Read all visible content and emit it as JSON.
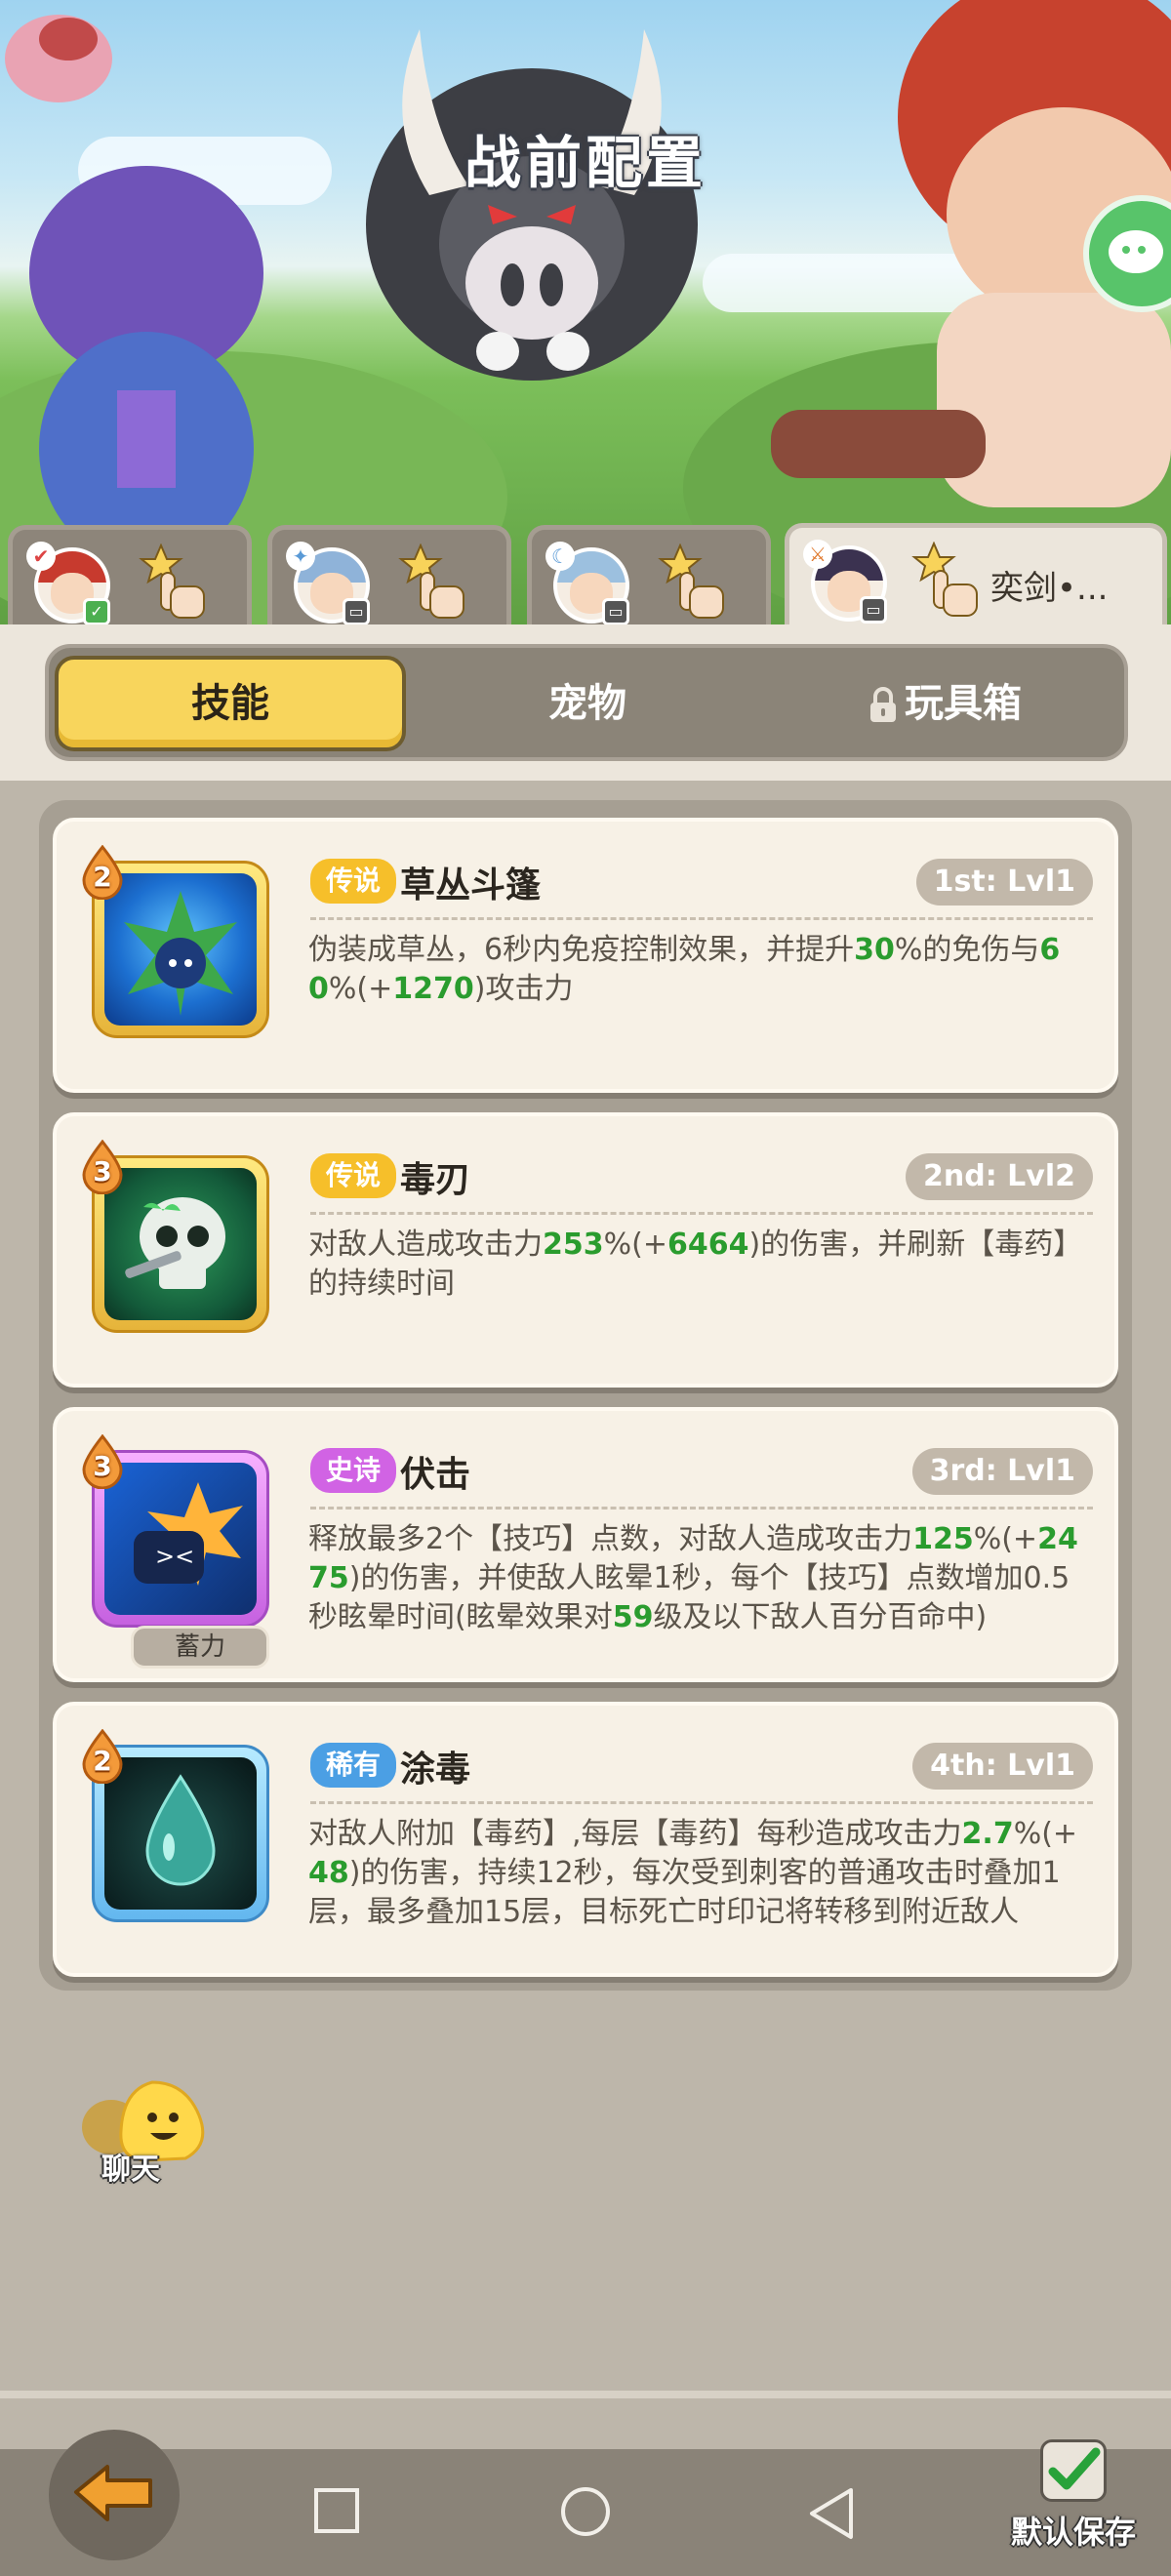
{
  "header": {
    "title": "战前配置"
  },
  "characters": [
    {
      "name": "",
      "badge_color": "#4caf50",
      "active": false
    },
    {
      "name": "",
      "badge_color": "#555555",
      "active": false
    },
    {
      "name": "",
      "badge_color": "#555555",
      "active": false
    },
    {
      "name": "奕剑•...",
      "badge_color": "#555555",
      "active": true
    }
  ],
  "tabs": {
    "skills": "技能",
    "pets": "宠物",
    "toybox": "玩具箱",
    "active": "skills"
  },
  "skills": [
    {
      "rarity": "传说",
      "name": "草丛斗篷",
      "slot_level": "1st: Lvl1",
      "tier": "2",
      "desc": [
        {
          "t": "伪装成草丛，6秒内免疫控制效果，并提升"
        },
        {
          "t": "30",
          "hl": true
        },
        {
          "t": "%的免伤与"
        },
        {
          "t": "60",
          "hl": true
        },
        {
          "t": "%(+"
        },
        {
          "t": "1270",
          "hl": true
        },
        {
          "t": ")攻击力"
        }
      ]
    },
    {
      "rarity": "传说",
      "name": "毒刃",
      "slot_level": "2nd: Lvl2",
      "tier": "3",
      "desc": [
        {
          "t": "对敌人造成攻击力"
        },
        {
          "t": "253",
          "hl": true
        },
        {
          "t": "%(+"
        },
        {
          "t": "6464",
          "hl": true
        },
        {
          "t": ")的伤害，并刷新【毒药】的持续时间"
        }
      ]
    },
    {
      "rarity": "史诗",
      "name": "伏击",
      "slot_level": "3rd: Lvl1",
      "tier": "3",
      "extra_label": "蓄力",
      "desc": [
        {
          "t": "释放最多2个【技巧】点数，对敌人造成攻击力"
        },
        {
          "t": "125",
          "hl": true
        },
        {
          "t": "%(+"
        },
        {
          "t": "2475",
          "hl": true
        },
        {
          "t": ")的伤害，并使敌人眩晕1秒，每个【技巧】点数增加0.5秒眩晕时间(眩晕效果对"
        },
        {
          "t": "59",
          "hl": true
        },
        {
          "t": "级及以下敌人百分百命中)"
        }
      ]
    },
    {
      "rarity": "稀有",
      "name": "涂毒",
      "slot_level": "4th: Lvl1",
      "tier": "2",
      "desc": [
        {
          "t": "对敌人附加【毒药】,每层【毒药】每秒造成攻击力"
        },
        {
          "t": "2.7",
          "hl": true
        },
        {
          "t": "%(+"
        },
        {
          "t": "48",
          "hl": true
        },
        {
          "t": ")的伤害，持续12秒，每次受到刺客的普通攻击时叠加1层，最多叠加15层，目标死亡时印记将转移到附近敌人"
        }
      ]
    }
  ],
  "chat": {
    "label": "聊天"
  },
  "save": {
    "label": "默认保存",
    "checked": true
  },
  "colors": {
    "highlight": "#2a9c2e",
    "tab_active": "#f8d55c",
    "legend": "#f6bf2a",
    "epic": "#d163e4",
    "rare": "#4b9fe4"
  }
}
